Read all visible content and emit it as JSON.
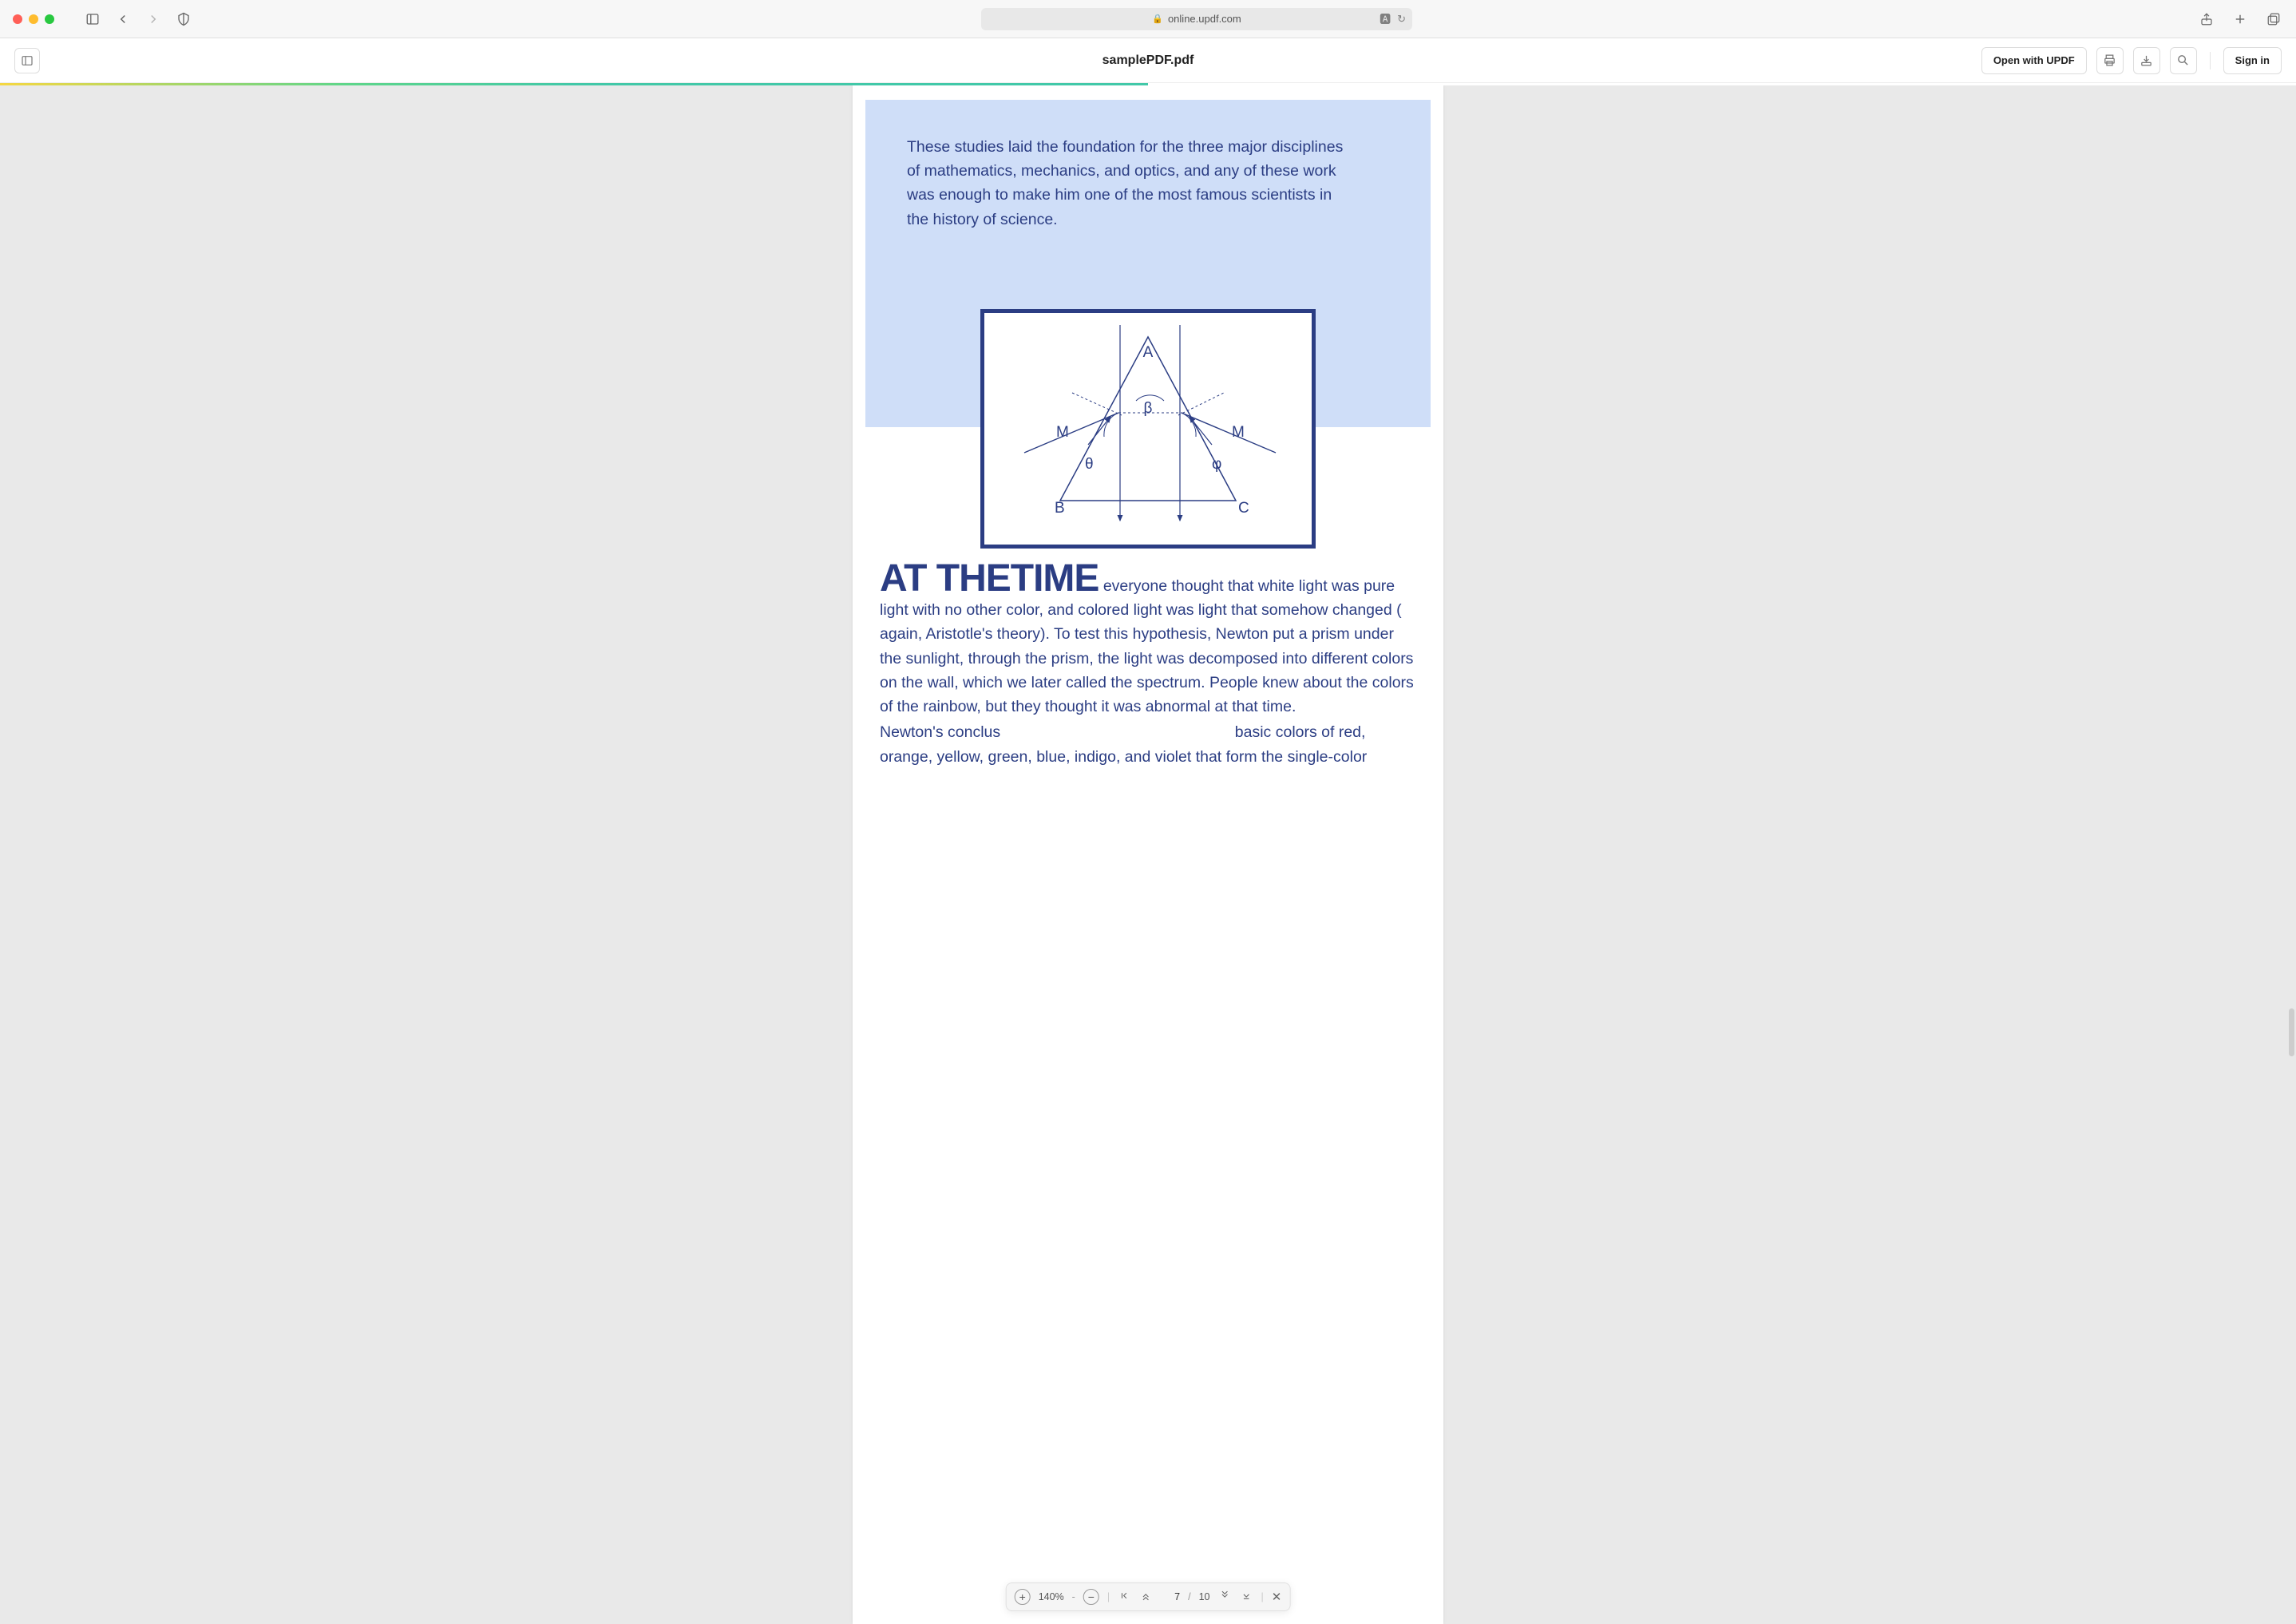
{
  "browser": {
    "url": "online.updf.com"
  },
  "header": {
    "doc_title": "samplePDF.pdf",
    "open_label": "Open with UPDF",
    "signin_label": "Sign in"
  },
  "content": {
    "callout_text": "These studies laid the foundation for the three major disciplines of mathematics, mechanics, and optics, and any of these work was enough to make him one of the most famous scientists in the history of science.",
    "prism_labels": {
      "A": "A",
      "B": "B",
      "C": "C",
      "M_left": "M",
      "M_right": "M",
      "beta": "β",
      "theta": "θ",
      "phi": "φ"
    },
    "dropcap": "AT THETIME",
    "body_inline": " everyone thought that white light was pure light with no other color, and colored light was light that somehow changed ( again, Aristotle's theory). To test this hypothesis, Newton put a prism under the sunlight, through the prism, the light was decomposed into different colors on the wall, which we later called the spectrum. People knew about the colors of the rainbow, but they thought it was abnormal at that time.",
    "body_para2_prefix": "Newton's conclus",
    "body_para2_suffix": "basic colors of red, orange, yellow, green, blue, indigo, and violet that form the single-color"
  },
  "toolbar": {
    "zoom": "140%",
    "zoom_sep": "-",
    "page_current": "7",
    "page_sep": "/",
    "page_total": "10"
  }
}
